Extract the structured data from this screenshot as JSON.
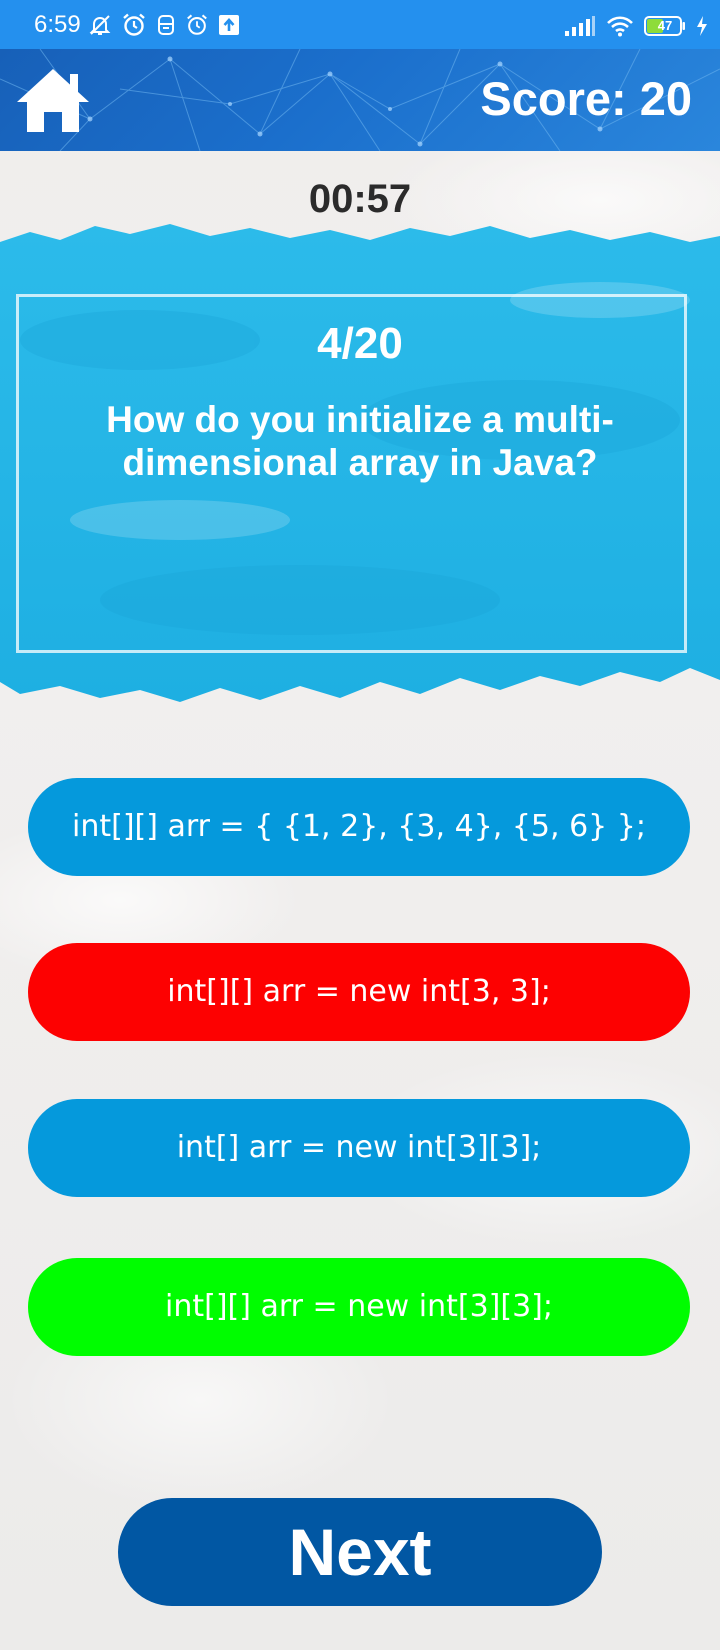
{
  "status_bar": {
    "time": "6:59",
    "battery_level": "47",
    "icons_left": [
      "muted-bell-icon",
      "alarm-icon",
      "notification-icon",
      "alarm-icon",
      "upload-icon"
    ],
    "icons_right": [
      "signal-icon",
      "wifi-icon",
      "battery-icon",
      "charging-icon"
    ]
  },
  "header": {
    "home_icon": "home-icon",
    "score": "Score: 20"
  },
  "timer": "00:57",
  "question": {
    "counter": "4/20",
    "text": "How do you initialize a multi-dimensional array in Java?"
  },
  "answers": [
    {
      "label": "int[][] arr = { {1, 2}, {3, 4}, {5, 6} };",
      "color": "#0599dc",
      "state": "neutral"
    },
    {
      "label": "int[][] arr = new int[3, 3];",
      "color": "#fd0101",
      "state": "wrong"
    },
    {
      "label": "int[] arr = new int[3][3];",
      "color": "#0599dc",
      "state": "neutral"
    },
    {
      "label": "int[][] arr = new int[3][3];",
      "color": "#00fd00",
      "state": "correct"
    }
  ],
  "next_label": "Next",
  "colors": {
    "status_bar": "#2490ee",
    "header": "#1b6fcc",
    "next_button": "#0157a3",
    "question_paint": "#22b4e6"
  }
}
